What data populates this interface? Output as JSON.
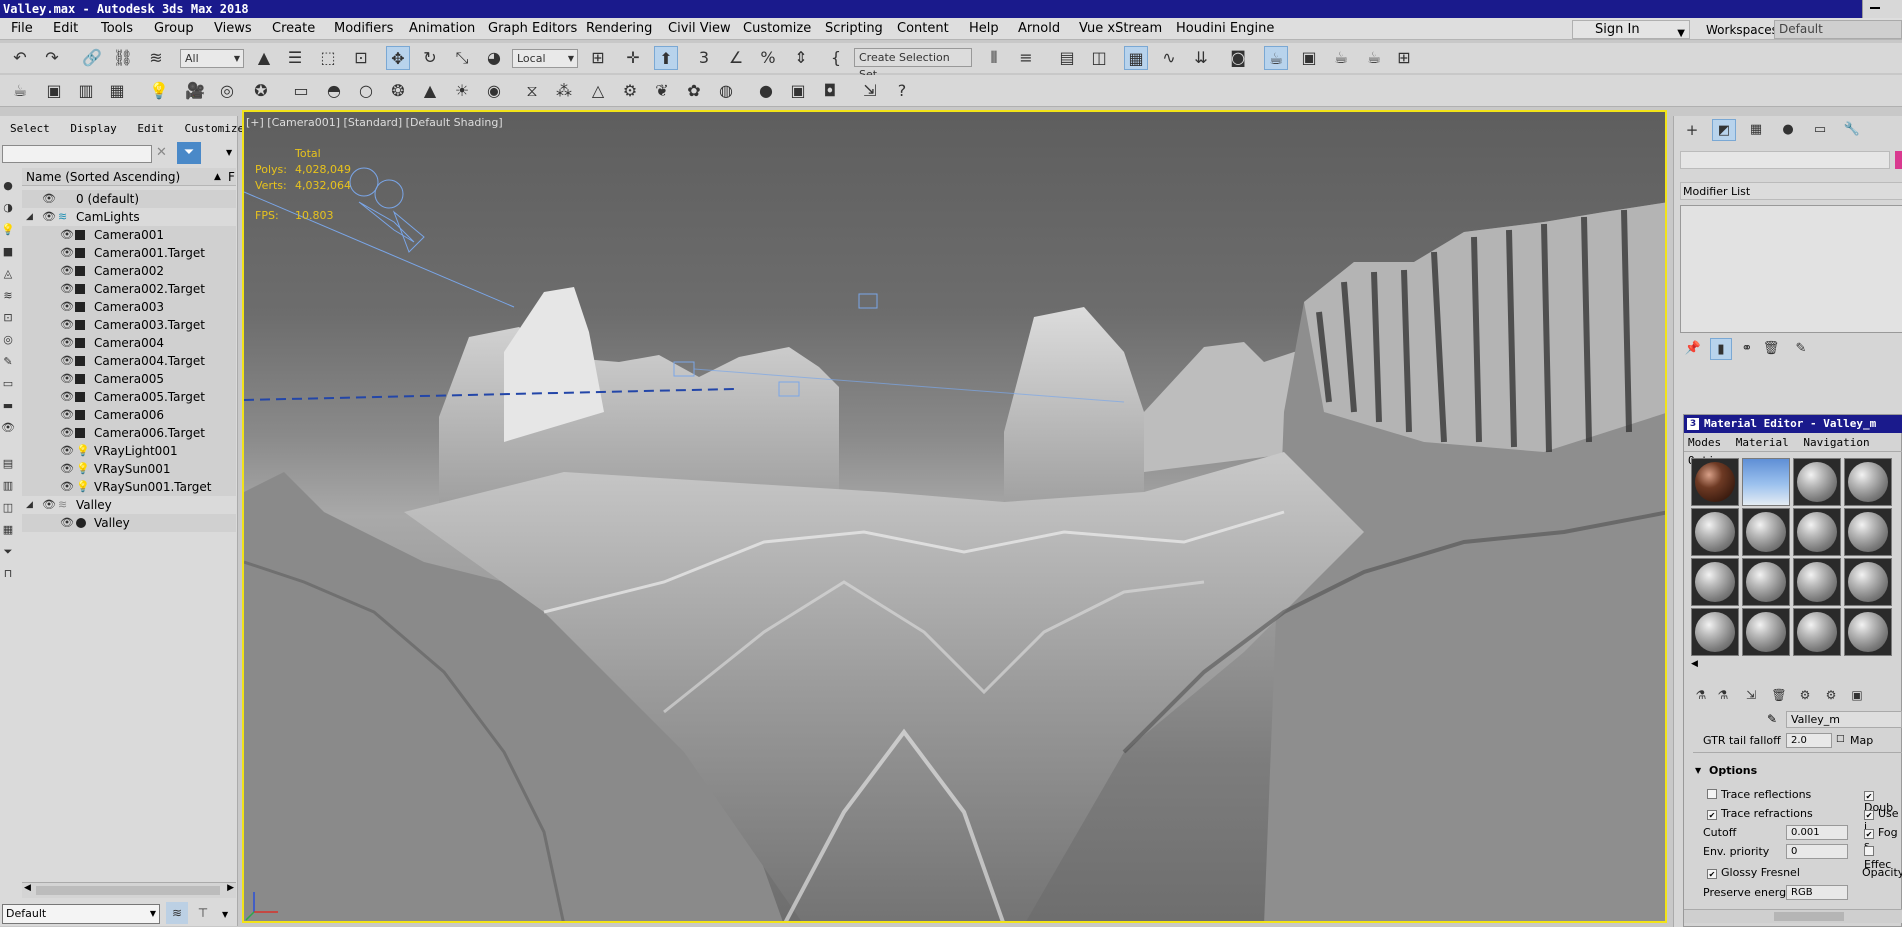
{
  "window": {
    "title": "Valley.max - Autodesk 3ds Max 2018"
  },
  "menubar": {
    "items": [
      "File",
      "Edit",
      "Tools",
      "Group",
      "Views",
      "Create",
      "Modifiers",
      "Animation",
      "Graph Editors",
      "Rendering",
      "Civil View",
      "Customize",
      "Scripting",
      "Content",
      "Help",
      "Arnold",
      "Vue xStream",
      "Houdini Engine"
    ],
    "sign_in": "Sign In",
    "workspaces_label": "Workspaces:",
    "workspace_value": "Default"
  },
  "toolbar": {
    "selection_filter": "All",
    "ref_coord": "Local",
    "named_selection_placeholder": "Create Selection Set"
  },
  "scene_explorer": {
    "tabs": [
      "Select",
      "Display",
      "Edit",
      "Customize"
    ],
    "column_header": "Name (Sorted Ascending)",
    "column_f": "F",
    "rows": [
      "0 (default)",
      "CamLights",
      "Camera001",
      "Camera001.Target",
      "Camera002",
      "Camera002.Target",
      "Camera003",
      "Camera003.Target",
      "Camera004",
      "Camera004.Target",
      "Camera005",
      "Camera005.Target",
      "Camera006",
      "Camera006.Target",
      "VRayLight001",
      "VRaySun001",
      "VRaySun001.Target",
      "Valley",
      "Valley"
    ],
    "layer_value": "Default"
  },
  "viewport": {
    "label": "[+] [Camera001] [Standard] [Default Shading]",
    "stats": {
      "total_label": "Total",
      "polys_label": "Polys:",
      "polys_value": "4,028,049",
      "verts_label": "Verts:",
      "verts_value": "4,032,064",
      "fps_label": "FPS:",
      "fps_value": "10.803"
    },
    "colors": {
      "active_border": "#f2e318",
      "stats_text": "#e8c31c"
    }
  },
  "command_panel": {
    "modifier_list": "Modifier List"
  },
  "material_editor": {
    "title": "Material Editor - Valley_m",
    "menu": [
      "Modes",
      "Material",
      "Navigation",
      "Options"
    ],
    "material_name": "Valley_m",
    "gtr_label": "GTR tail falloff",
    "gtr_value": "2.0",
    "map_label": "Map",
    "options_header": "Options",
    "trace_reflections": "Trace reflections",
    "trace_refractions": "Trace refractions",
    "cutoff_label": "Cutoff",
    "cutoff_value": "0.001",
    "env_priority_label": "Env. priority",
    "env_priority_value": "0",
    "glossy_fresnel": "Glossy Fresnel",
    "preserve_energy_label": "Preserve energy",
    "preserve_energy_value": "RGB",
    "right_col": [
      "Doub",
      "Use i",
      "Fog s",
      "Effec",
      "Opacity"
    ]
  }
}
